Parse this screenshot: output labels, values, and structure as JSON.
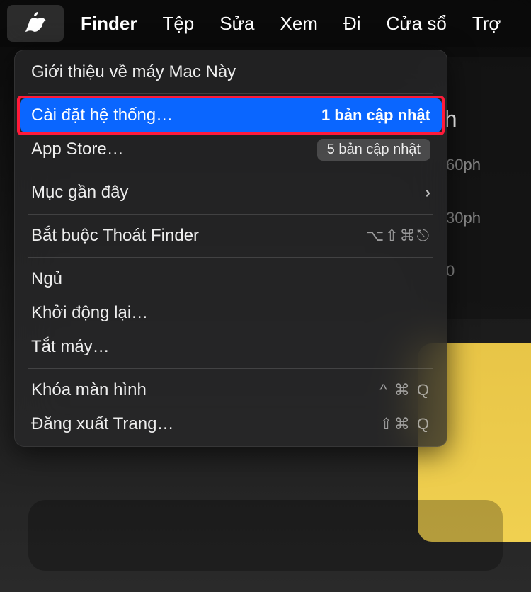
{
  "menubar": {
    "finder": "Finder",
    "file": "Tệp",
    "edit": "Sửa",
    "view": "Xem",
    "go": "Đi",
    "window": "Cửa sổ",
    "help": "Trợ"
  },
  "menu": {
    "about": "Giới thiệu về máy Mac Này",
    "system_settings": "Cài đặt hệ thống…",
    "system_settings_badge": "1 bản cập nhật",
    "app_store": "App Store…",
    "app_store_badge": "5 bản cập nhật",
    "recent": "Mục gần đây",
    "force_quit": "Bắt buộc Thoát Finder",
    "force_quit_shortcut": "⌥⇧⌘⎋",
    "sleep": "Ngủ",
    "restart": "Khởi động lại…",
    "shutdown": "Tắt máy…",
    "lock": "Khóa màn hình",
    "lock_shortcut": "^ ⌘ Q",
    "logout": "Đăng xuất Trang…",
    "logout_shortcut": "⇧⌘ Q"
  },
  "bg": {
    "title_suffix": "oh",
    "stat1": "60ph",
    "stat2": "30ph",
    "stat3": "0"
  }
}
